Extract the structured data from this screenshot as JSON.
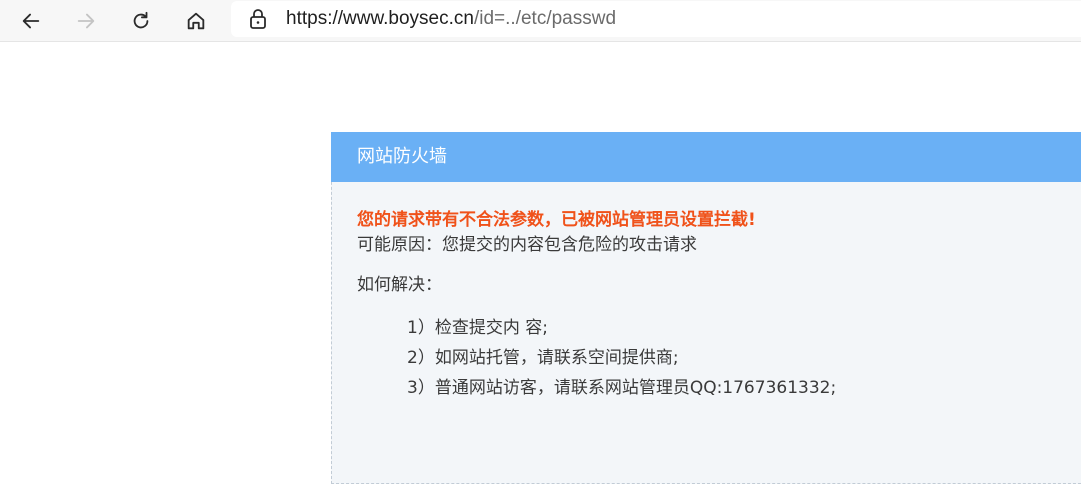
{
  "browser": {
    "url_host": "https://www.boysec.cn",
    "url_rest": "/id=../etc/passwd",
    "icons": {
      "back": "arrow-left-icon",
      "forward": "arrow-right-icon",
      "refresh": "refresh-icon",
      "home": "home-icon",
      "lock": "lock-icon"
    }
  },
  "firewall": {
    "title": "网站防火墙",
    "alert": "您的请求带有不合法参数，已被网站管理员设置拦截!",
    "reason": "可能原因：您提交的内容包含危险的攻击请求",
    "howto": "如何解决：",
    "steps": [
      "1）检查提交内 容;",
      "2）如网站托管，请联系空间提供商;",
      "3）普通网站访客，请联系网站管理员QQ:1767361332;"
    ],
    "colors": {
      "header": "#6ab0f5",
      "alert": "#f0521a",
      "panel": "#f3f6f9"
    }
  }
}
